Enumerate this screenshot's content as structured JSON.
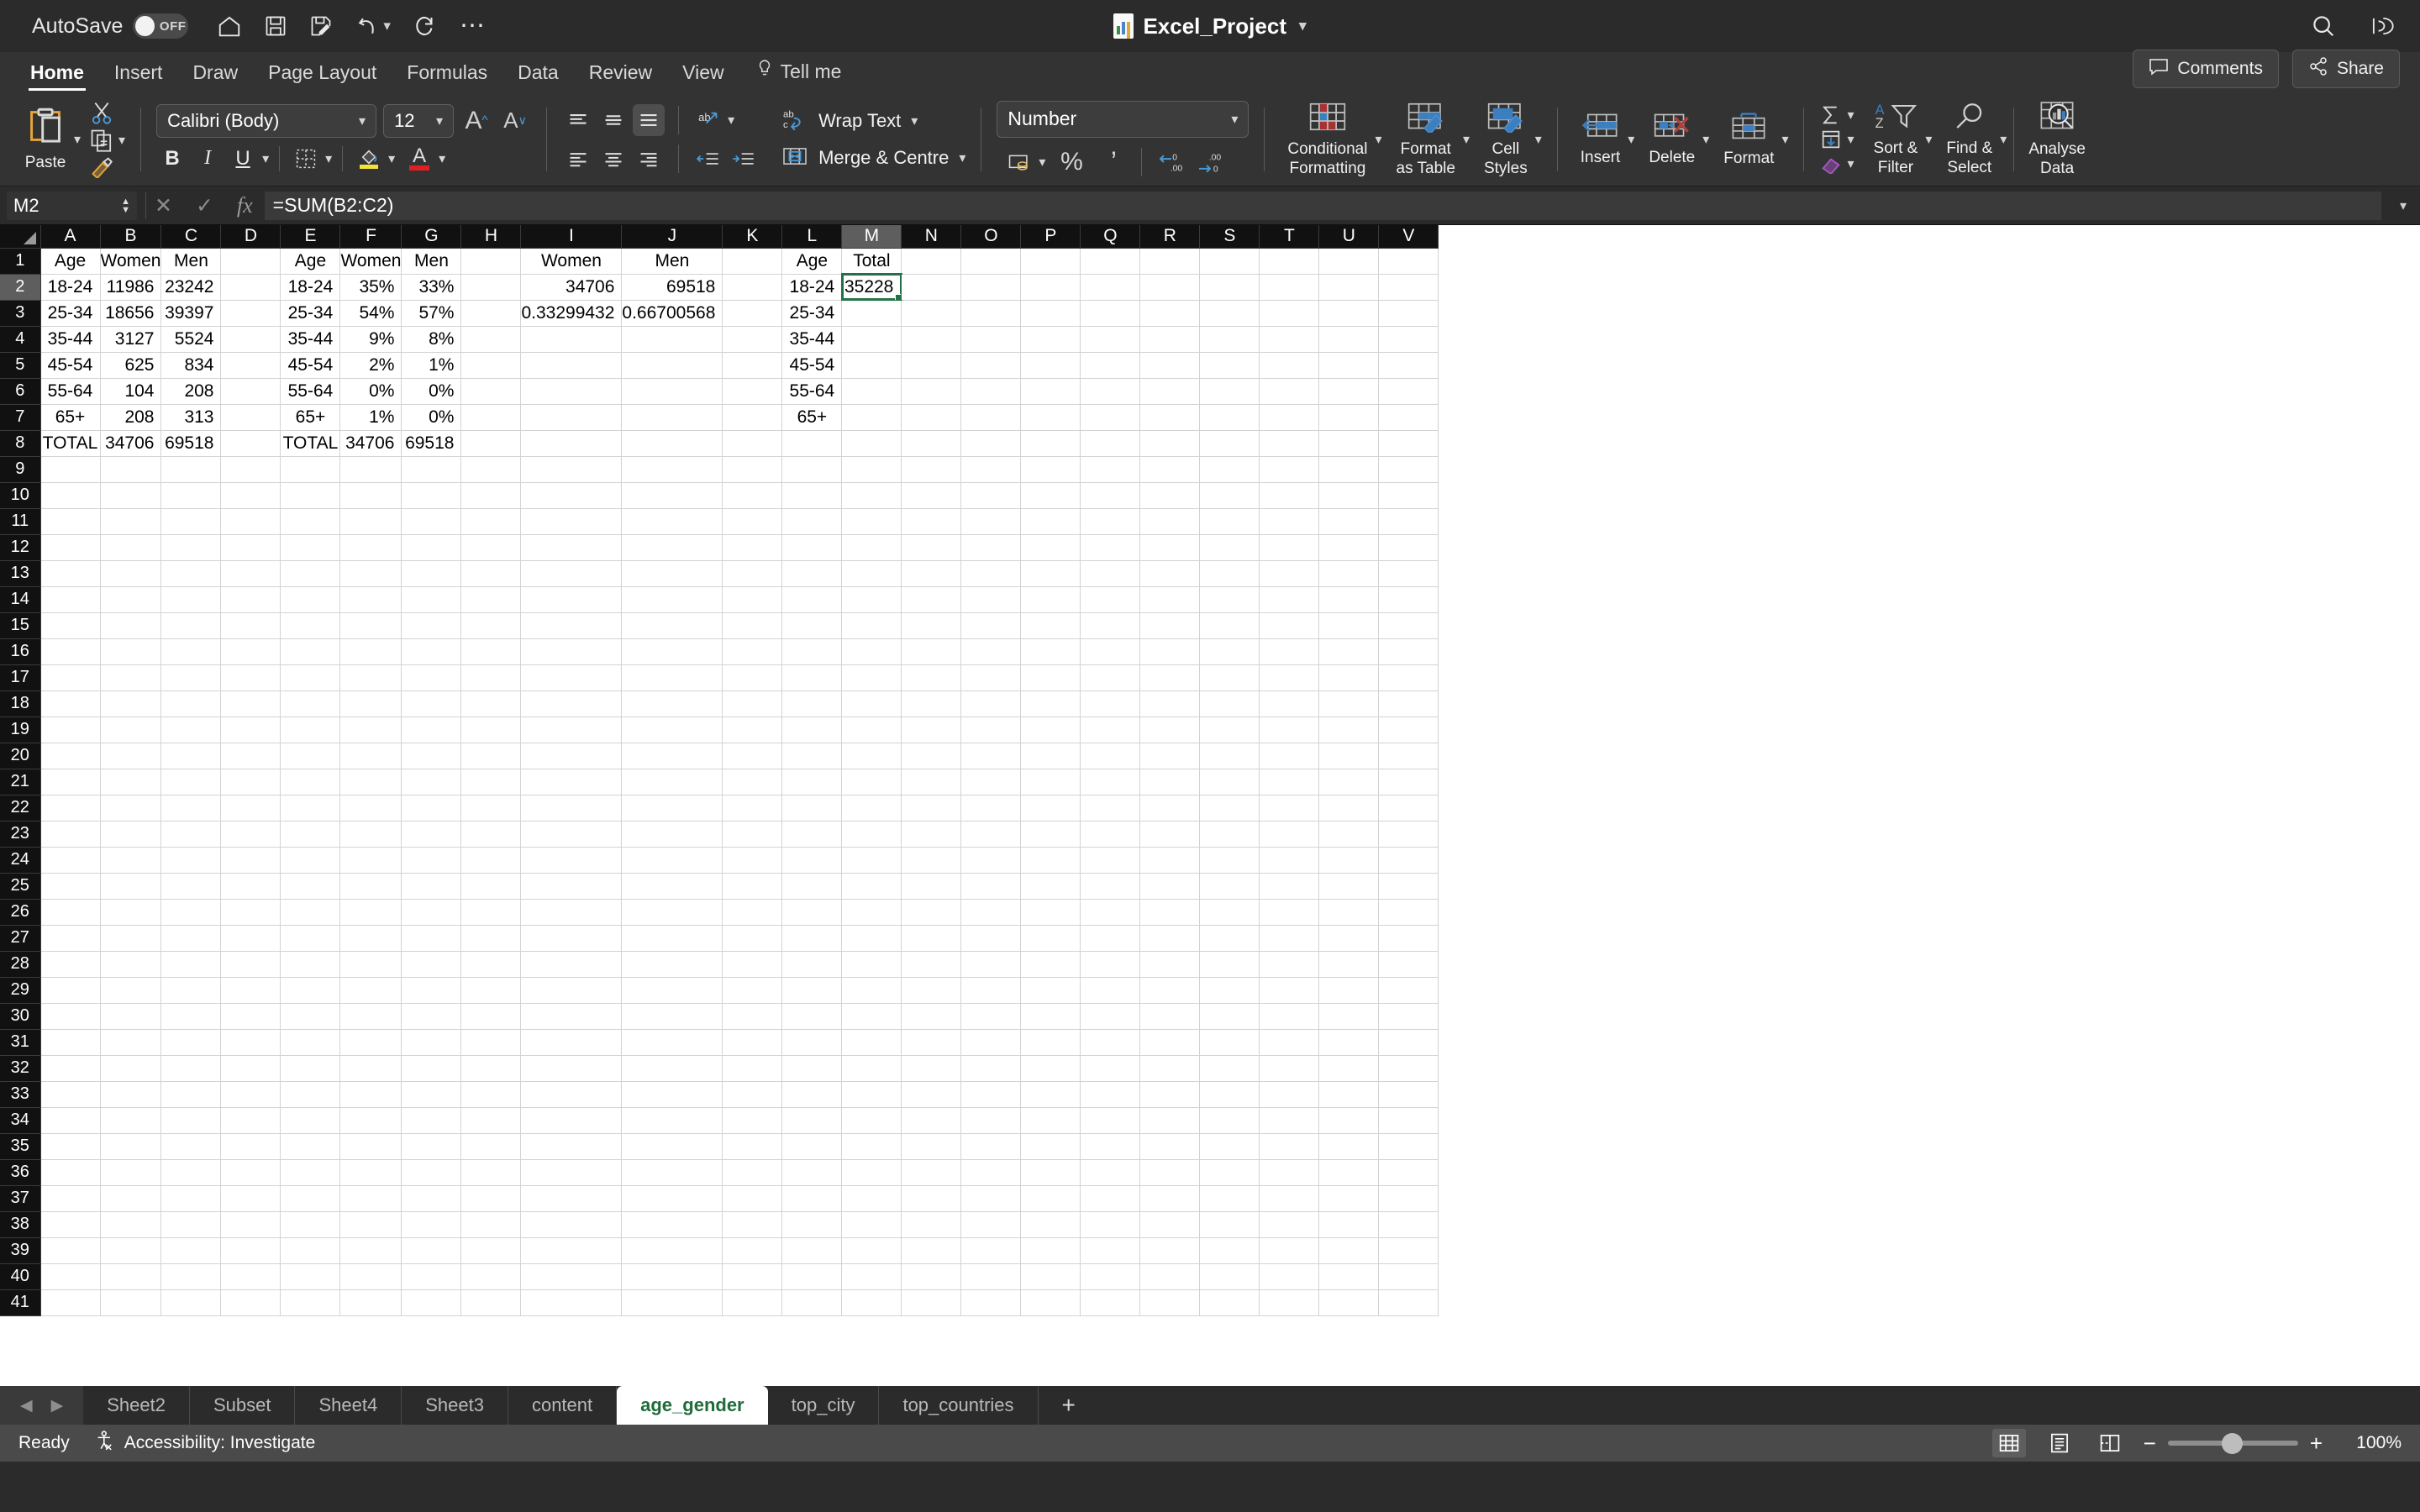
{
  "titlebar": {
    "autosave_label": "AutoSave",
    "autosave_state": "OFF",
    "document_title": "Excel_Project",
    "quick_access": [
      {
        "name": "home-icon",
        "glyph": "⌂"
      },
      {
        "name": "save-icon",
        "glyph": "💾"
      },
      {
        "name": "save-as-icon",
        "glyph": "💾"
      },
      {
        "name": "undo-icon",
        "glyph": "↶"
      },
      {
        "name": "redo-icon",
        "glyph": "↻"
      },
      {
        "name": "more-options-icon",
        "glyph": "⋯"
      }
    ],
    "search_icon": "search-icon",
    "account_icon": "account-icon"
  },
  "ribbon_tabs": {
    "items": [
      "Home",
      "Insert",
      "Draw",
      "Page Layout",
      "Formulas",
      "Data",
      "Review",
      "View"
    ],
    "active": "Home",
    "tell_me": "Tell me",
    "comments_label": "Comments",
    "share_label": "Share"
  },
  "ribbon": {
    "paste_label": "Paste",
    "cut_icon": "scissors-icon",
    "copy_icon": "copy-icon",
    "format_painter_icon": "format-painter-icon",
    "font_name": "Calibri (Body)",
    "font_size": "12",
    "grow_font_icon": "increase-font-size-icon",
    "shrink_font_icon": "decrease-font-size-icon",
    "bold": "B",
    "italic": "I",
    "underline": "U",
    "borders_icon": "borders-icon",
    "fill_color_icon": "fill-color-icon",
    "font_color_icon": "font-color-icon",
    "orientation_icon": "text-orientation-icon",
    "decrease_indent_icon": "decrease-indent-icon",
    "increase_indent_icon": "increase-indent-icon",
    "wrap_text_label": "Wrap Text",
    "merge_centre_label": "Merge & Centre",
    "number_format": "Number",
    "accounting_icon": "accounting-format-icon",
    "percent_label": "%",
    "comma_label": "’",
    "increase_decimal_icon": "increase-decimal-icon",
    "decrease_decimal_icon": "decrease-decimal-icon",
    "conditional_formatting_label": "Conditional\nFormatting",
    "conditional_formatting_line1": "Conditional",
    "conditional_formatting_line2": "Formatting",
    "format_as_table_line1": "Format",
    "format_as_table_line2": "as Table",
    "cell_styles_line1": "Cell",
    "cell_styles_line2": "Styles",
    "insert_label": "Insert",
    "delete_label": "Delete",
    "format_label": "Format",
    "autosum_icon": "autosum-icon",
    "fill_icon": "fill-down-icon",
    "clear_icon": "clear-icon",
    "sort_filter_line1": "Sort &",
    "sort_filter_line2": "Filter",
    "find_select_line1": "Find &",
    "find_select_line2": "Select",
    "analyse_data_line1": "Analyse",
    "analyse_data_line2": "Data"
  },
  "formula_bar": {
    "name_box": "M2",
    "cancel_icon": "cancel-icon",
    "confirm_icon": "confirm-icon",
    "fx_icon": "function-icon",
    "formula": "=SUM(B2:C2)",
    "expand_icon": "expand-formula-bar-icon"
  },
  "grid": {
    "columns": [
      "A",
      "B",
      "C",
      "D",
      "E",
      "F",
      "G",
      "H",
      "I",
      "J",
      "K",
      "L",
      "M",
      "N",
      "O",
      "P",
      "Q",
      "R",
      "S",
      "T",
      "U",
      "V"
    ],
    "selected_column": "M",
    "selected_row": 2,
    "active_cell": "M2",
    "row_count": 41,
    "rows": [
      {
        "n": 1,
        "cells": {
          "A": "Age",
          "B": "Women",
          "C": "Men",
          "E": "Age",
          "F": "Women",
          "G": "Men",
          "I": "Women",
          "J": "Men",
          "L": "Age",
          "M": "Total"
        }
      },
      {
        "n": 2,
        "cells": {
          "A": "18-24",
          "B": "11986",
          "C": "23242",
          "E": "18-24",
          "F": "35%",
          "G": "33%",
          "I": "34706",
          "J": "69518",
          "L": "18-24",
          "M": "35228"
        }
      },
      {
        "n": 3,
        "cells": {
          "A": "25-34",
          "B": "18656",
          "C": "39397",
          "E": "25-34",
          "F": "54%",
          "G": "57%",
          "I": "0.33299432",
          "J": "0.66700568",
          "L": "25-34"
        }
      },
      {
        "n": 4,
        "cells": {
          "A": "35-44",
          "B": "3127",
          "C": "5524",
          "E": "35-44",
          "F": "9%",
          "G": "8%",
          "L": "35-44"
        }
      },
      {
        "n": 5,
        "cells": {
          "A": "45-54",
          "B": "625",
          "C": "834",
          "E": "45-54",
          "F": "2%",
          "G": "1%",
          "L": "45-54"
        }
      },
      {
        "n": 6,
        "cells": {
          "A": "55-64",
          "B": "104",
          "C": "208",
          "E": "55-64",
          "F": "0%",
          "G": "0%",
          "L": "55-64"
        }
      },
      {
        "n": 7,
        "cells": {
          "A": "65+",
          "B": "208",
          "C": "313",
          "E": "65+",
          "F": "1%",
          "G": "0%",
          "L": "65+"
        }
      },
      {
        "n": 8,
        "cells": {
          "A": "TOTAL",
          "B": "34706",
          "C": "69518",
          "E": "TOTAL",
          "F": "34706",
          "G": "69518"
        }
      },
      {
        "n": 9,
        "cells": {}
      },
      {
        "n": 10,
        "cells": {}
      },
      {
        "n": 11,
        "cells": {}
      },
      {
        "n": 12,
        "cells": {}
      },
      {
        "n": 13,
        "cells": {}
      },
      {
        "n": 14,
        "cells": {}
      },
      {
        "n": 15,
        "cells": {}
      },
      {
        "n": 16,
        "cells": {}
      },
      {
        "n": 17,
        "cells": {}
      },
      {
        "n": 18,
        "cells": {}
      },
      {
        "n": 19,
        "cells": {}
      },
      {
        "n": 20,
        "cells": {}
      },
      {
        "n": 21,
        "cells": {}
      },
      {
        "n": 22,
        "cells": {}
      },
      {
        "n": 23,
        "cells": {}
      },
      {
        "n": 24,
        "cells": {}
      },
      {
        "n": 25,
        "cells": {}
      },
      {
        "n": 26,
        "cells": {}
      },
      {
        "n": 27,
        "cells": {}
      },
      {
        "n": 28,
        "cells": {}
      },
      {
        "n": 29,
        "cells": {}
      },
      {
        "n": 30,
        "cells": {}
      },
      {
        "n": 31,
        "cells": {}
      },
      {
        "n": 32,
        "cells": {}
      },
      {
        "n": 33,
        "cells": {}
      },
      {
        "n": 34,
        "cells": {}
      },
      {
        "n": 35,
        "cells": {}
      },
      {
        "n": 36,
        "cells": {}
      },
      {
        "n": 37,
        "cells": {}
      },
      {
        "n": 38,
        "cells": {}
      },
      {
        "n": 39,
        "cells": {}
      },
      {
        "n": 40,
        "cells": {}
      },
      {
        "n": 41,
        "cells": {}
      }
    ]
  },
  "sheet_tabs": {
    "items": [
      "Sheet2",
      "Subset",
      "Sheet4",
      "Sheet3",
      "content",
      "age_gender",
      "top_city",
      "top_countries"
    ],
    "active": "age_gender",
    "add_label": "+",
    "prev_icon": "previous-sheet-icon",
    "next_icon": "next-sheet-icon"
  },
  "status_bar": {
    "state": "Ready",
    "accessibility": "Accessibility: Investigate",
    "views": [
      "normal-view-icon",
      "page-layout-view-icon",
      "page-break-view-icon"
    ],
    "active_view": "normal-view-icon",
    "zoom_out": "−",
    "zoom_in": "+",
    "zoom": "100%"
  }
}
